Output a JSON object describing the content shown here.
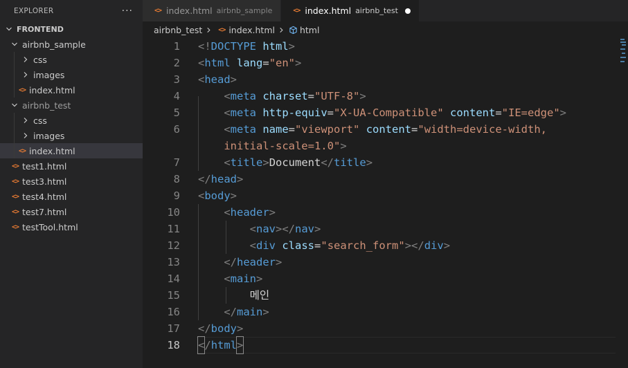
{
  "explorer": {
    "title": "EXPLORER",
    "more_icon": "ellipsis-icon",
    "section": "FRONTEND",
    "items": [
      {
        "label": "airbnb_sample",
        "kind": "folder",
        "expanded": true
      },
      {
        "label": "css",
        "kind": "folder",
        "expanded": false
      },
      {
        "label": "images",
        "kind": "folder",
        "expanded": false
      },
      {
        "label": "index.html",
        "kind": "html-file"
      },
      {
        "label": "airbnb_test",
        "kind": "folder",
        "expanded": true
      },
      {
        "label": "css",
        "kind": "folder",
        "expanded": false
      },
      {
        "label": "images",
        "kind": "folder",
        "expanded": false
      },
      {
        "label": "index.html",
        "kind": "html-file",
        "selected": true
      },
      {
        "label": "test1.html",
        "kind": "html-file"
      },
      {
        "label": "test3.html",
        "kind": "html-file"
      },
      {
        "label": "test4.html",
        "kind": "html-file"
      },
      {
        "label": "test7.html",
        "kind": "html-file"
      },
      {
        "label": "testTool.html",
        "kind": "html-file"
      }
    ]
  },
  "tabs": [
    {
      "name": "index.html",
      "description": "airbnb_sample",
      "active": false
    },
    {
      "name": "index.html",
      "description": "airbnb_test",
      "active": true,
      "dirty": true
    }
  ],
  "breadcrumbs": {
    "folder": "airbnb_test",
    "file": "index.html",
    "symbol": "html"
  },
  "editor": {
    "line_numbers": [
      "1",
      "2",
      "3",
      "4",
      "5",
      "6",
      "",
      "7",
      "8",
      "9",
      "10",
      "11",
      "12",
      "13",
      "14",
      "15",
      "16",
      "17",
      "18"
    ],
    "current_line": "18",
    "lines": [
      [
        {
          "t": "<!",
          "c": "tk-tag-br"
        },
        {
          "t": "DOCTYPE",
          "c": "tk-tag"
        },
        {
          "t": " ",
          "c": "tk-text"
        },
        {
          "t": "html",
          "c": "tk-attr"
        },
        {
          "t": ">",
          "c": "tk-tag-br"
        }
      ],
      [
        {
          "t": "<",
          "c": "tk-tag-br"
        },
        {
          "t": "html",
          "c": "tk-tag"
        },
        {
          "t": " ",
          "c": "tk-text"
        },
        {
          "t": "lang",
          "c": "tk-attr"
        },
        {
          "t": "=",
          "c": "tk-text"
        },
        {
          "t": "\"en\"",
          "c": "tk-str"
        },
        {
          "t": ">",
          "c": "tk-tag-br"
        }
      ],
      [
        {
          "t": "<",
          "c": "tk-tag-br"
        },
        {
          "t": "head",
          "c": "tk-tag"
        },
        {
          "t": ">",
          "c": "tk-tag-br"
        }
      ],
      [
        {
          "t": "    ",
          "c": "tk-text"
        },
        {
          "t": "<",
          "c": "tk-tag-br"
        },
        {
          "t": "meta",
          "c": "tk-tag"
        },
        {
          "t": " ",
          "c": "tk-text"
        },
        {
          "t": "charset",
          "c": "tk-attr"
        },
        {
          "t": "=",
          "c": "tk-text"
        },
        {
          "t": "\"UTF-8\"",
          "c": "tk-str"
        },
        {
          "t": ">",
          "c": "tk-tag-br"
        }
      ],
      [
        {
          "t": "    ",
          "c": "tk-text"
        },
        {
          "t": "<",
          "c": "tk-tag-br"
        },
        {
          "t": "meta",
          "c": "tk-tag"
        },
        {
          "t": " ",
          "c": "tk-text"
        },
        {
          "t": "http-equiv",
          "c": "tk-attr"
        },
        {
          "t": "=",
          "c": "tk-text"
        },
        {
          "t": "\"X-UA-Compatible\"",
          "c": "tk-str"
        },
        {
          "t": " ",
          "c": "tk-text"
        },
        {
          "t": "content",
          "c": "tk-attr"
        },
        {
          "t": "=",
          "c": "tk-text"
        },
        {
          "t": "\"IE=edge\"",
          "c": "tk-str"
        },
        {
          "t": ">",
          "c": "tk-tag-br"
        }
      ],
      [
        {
          "t": "    ",
          "c": "tk-text"
        },
        {
          "t": "<",
          "c": "tk-tag-br"
        },
        {
          "t": "meta",
          "c": "tk-tag"
        },
        {
          "t": " ",
          "c": "tk-text"
        },
        {
          "t": "name",
          "c": "tk-attr"
        },
        {
          "t": "=",
          "c": "tk-text"
        },
        {
          "t": "\"viewport\"",
          "c": "tk-str"
        },
        {
          "t": " ",
          "c": "tk-text"
        },
        {
          "t": "content",
          "c": "tk-attr"
        },
        {
          "t": "=",
          "c": "tk-text"
        },
        {
          "t": "\"width=device-width,",
          "c": "tk-str"
        }
      ],
      [
        {
          "t": "    ",
          "c": "tk-text"
        },
        {
          "t": "initial-scale=1.0\"",
          "c": "tk-str"
        },
        {
          "t": ">",
          "c": "tk-tag-br"
        }
      ],
      [
        {
          "t": "    ",
          "c": "tk-text"
        },
        {
          "t": "<",
          "c": "tk-tag-br"
        },
        {
          "t": "title",
          "c": "tk-tag"
        },
        {
          "t": ">",
          "c": "tk-tag-br"
        },
        {
          "t": "Document",
          "c": "tk-text"
        },
        {
          "t": "</",
          "c": "tk-tag-br"
        },
        {
          "t": "title",
          "c": "tk-tag"
        },
        {
          "t": ">",
          "c": "tk-tag-br"
        }
      ],
      [
        {
          "t": "</",
          "c": "tk-tag-br"
        },
        {
          "t": "head",
          "c": "tk-tag"
        },
        {
          "t": ">",
          "c": "tk-tag-br"
        }
      ],
      [
        {
          "t": "<",
          "c": "tk-tag-br"
        },
        {
          "t": "body",
          "c": "tk-tag"
        },
        {
          "t": ">",
          "c": "tk-tag-br"
        }
      ],
      [
        {
          "t": "    ",
          "c": "tk-text"
        },
        {
          "t": "<",
          "c": "tk-tag-br"
        },
        {
          "t": "header",
          "c": "tk-tag"
        },
        {
          "t": ">",
          "c": "tk-tag-br"
        }
      ],
      [
        {
          "t": "        ",
          "c": "tk-text"
        },
        {
          "t": "<",
          "c": "tk-tag-br"
        },
        {
          "t": "nav",
          "c": "tk-tag"
        },
        {
          "t": "></",
          "c": "tk-tag-br"
        },
        {
          "t": "nav",
          "c": "tk-tag"
        },
        {
          "t": ">",
          "c": "tk-tag-br"
        }
      ],
      [
        {
          "t": "        ",
          "c": "tk-text"
        },
        {
          "t": "<",
          "c": "tk-tag-br"
        },
        {
          "t": "div",
          "c": "tk-tag"
        },
        {
          "t": " ",
          "c": "tk-text"
        },
        {
          "t": "class",
          "c": "tk-attr"
        },
        {
          "t": "=",
          "c": "tk-text"
        },
        {
          "t": "\"search_form\"",
          "c": "tk-str"
        },
        {
          "t": "></",
          "c": "tk-tag-br"
        },
        {
          "t": "div",
          "c": "tk-tag"
        },
        {
          "t": ">",
          "c": "tk-tag-br"
        }
      ],
      [
        {
          "t": "    ",
          "c": "tk-text"
        },
        {
          "t": "</",
          "c": "tk-tag-br"
        },
        {
          "t": "header",
          "c": "tk-tag"
        },
        {
          "t": ">",
          "c": "tk-tag-br"
        }
      ],
      [
        {
          "t": "    ",
          "c": "tk-text"
        },
        {
          "t": "<",
          "c": "tk-tag-br"
        },
        {
          "t": "main",
          "c": "tk-tag"
        },
        {
          "t": ">",
          "c": "tk-tag-br"
        }
      ],
      [
        {
          "t": "        ",
          "c": "tk-text"
        },
        {
          "t": "메인",
          "c": "tk-text"
        }
      ],
      [
        {
          "t": "    ",
          "c": "tk-text"
        },
        {
          "t": "</",
          "c": "tk-tag-br"
        },
        {
          "t": "main",
          "c": "tk-tag"
        },
        {
          "t": ">",
          "c": "tk-tag-br"
        }
      ],
      [
        {
          "t": "</",
          "c": "tk-tag-br"
        },
        {
          "t": "body",
          "c": "tk-tag"
        },
        {
          "t": ">",
          "c": "tk-tag-br"
        }
      ],
      [
        {
          "t": "<",
          "c": "tk-tag-br",
          "box": true
        },
        {
          "t": "/",
          "c": "tk-tag-br"
        },
        {
          "t": "html",
          "c": "tk-tag"
        },
        {
          "t": ">",
          "c": "tk-tag-br",
          "box": true
        }
      ]
    ]
  },
  "colors": {
    "html_icon": "#e37933",
    "selection": "#37373d",
    "keyword": "#569cd6",
    "attribute": "#9cdcfe",
    "string": "#ce9178"
  }
}
